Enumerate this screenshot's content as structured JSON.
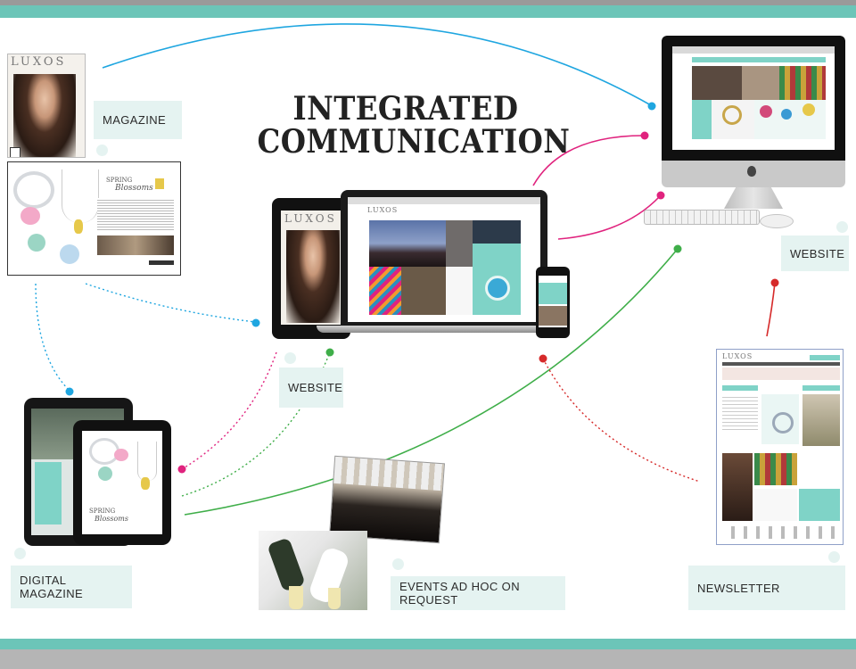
{
  "title": {
    "line1": "INTEGRATED",
    "line2": "COMMUNICATION"
  },
  "labels": {
    "magazine": "MAGAZINE",
    "website_top": "WEBSITE",
    "website_center": "WEBSITE",
    "digital_magazine": "DIGITAL MAGAZINE",
    "events": "EVENTS AD HOC ON REQUEST",
    "newsletter": "NEWSLETTER"
  },
  "mockups": {
    "brand": "LUXOS",
    "spring": "SPRING",
    "blossoms": "Blossoms"
  },
  "colors": {
    "teal_frame": "#6cc5b8",
    "label_bg": "#e5f3f1",
    "blue": "#1fa6e0",
    "magenta": "#e0237e",
    "green": "#3fae49",
    "red": "#d62a2a"
  }
}
